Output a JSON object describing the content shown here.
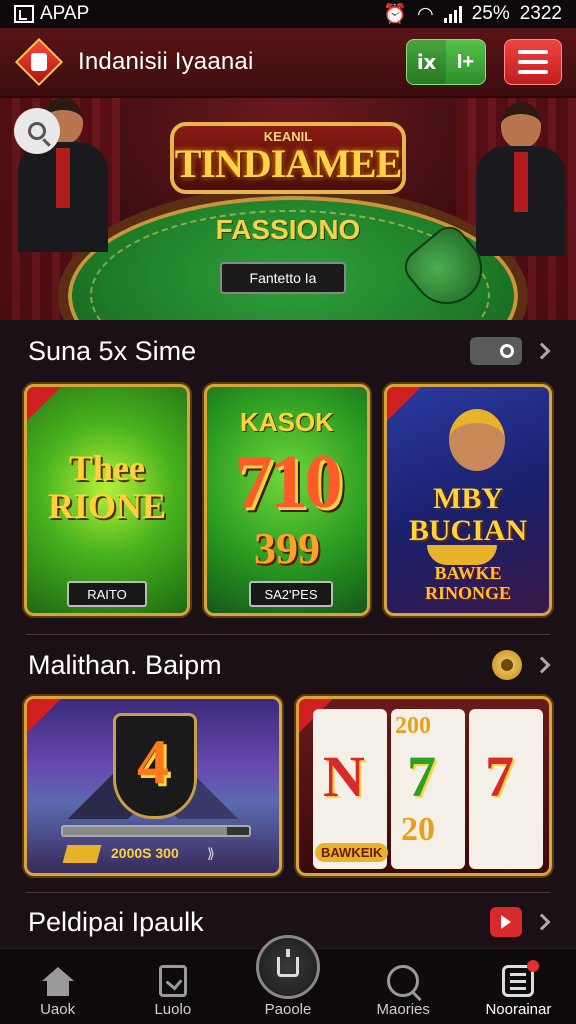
{
  "status_bar": {
    "left_text": "APAP",
    "battery": "25%",
    "time": "2322"
  },
  "header": {
    "app_title": "Indanisii Iyaanai",
    "green_button_left": "ⅸ",
    "green_button_right": "I+"
  },
  "hero": {
    "plate_small": "KEANIL",
    "plate_title": "TINDIAMEE",
    "subtitle": "FASSIONO",
    "button_label": "Fantetto Ia"
  },
  "sections": [
    {
      "title": "Suna 5x Sime",
      "cards": [
        {
          "art_text": "Thee RIONE",
          "label": "RAITO"
        },
        {
          "art_top": "KASOK",
          "art_main": "710",
          "art_sub": "399",
          "label": "SA2'PES"
        },
        {
          "art_main": "MBY BUCIAN",
          "art_sub": "BAWKE RINONGE"
        }
      ]
    },
    {
      "title": "Malithan. Baipm",
      "cards": [
        {
          "art_main": "4",
          "jackpot": "2000S 300"
        },
        {
          "reels": [
            "N",
            "7",
            "7"
          ],
          "reel_top": "200",
          "reel_bottom": "20",
          "label": "BAWKEIK"
        }
      ]
    },
    {
      "title": "Peldipai Ipaulk"
    }
  ],
  "bottom_nav": [
    {
      "label": "Uaok",
      "icon": "home-icon"
    },
    {
      "label": "Luolo",
      "icon": "document-icon"
    },
    {
      "label": "Paoole",
      "icon": "wallet-icon"
    },
    {
      "label": "Maories",
      "icon": "search-icon"
    },
    {
      "label": "Noorainar",
      "icon": "list-icon"
    }
  ],
  "colors": {
    "accent_red": "#d82a2a",
    "accent_green": "#2e8e2a",
    "gold": "#d9a43b",
    "background": "#1b1016"
  }
}
